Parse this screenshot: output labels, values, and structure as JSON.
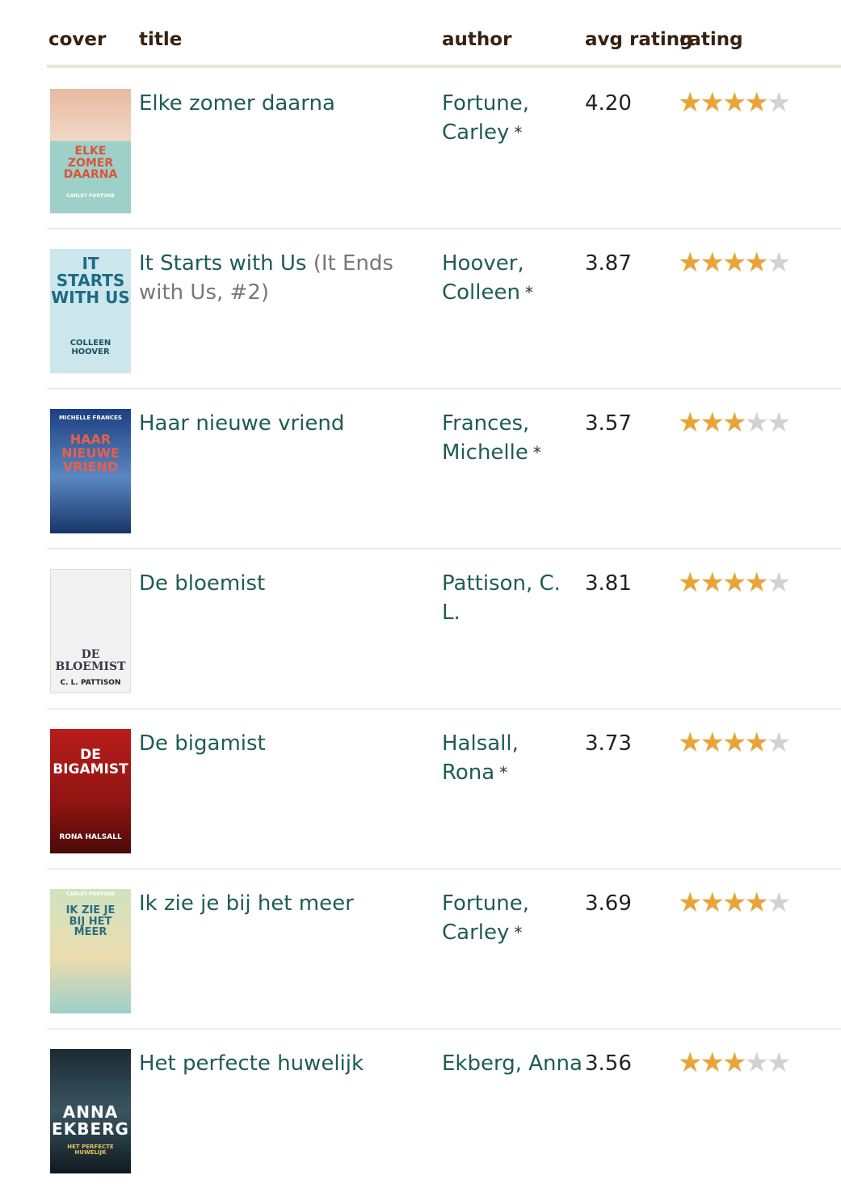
{
  "header": {
    "cover": "cover",
    "title": "title",
    "author": "author",
    "avg_rating": "avg rating",
    "rating": "rating"
  },
  "colors": {
    "link": "#1e5c55",
    "header_text": "#382110",
    "star_on": "#e8a43a",
    "star_off": "#d2d2d2"
  },
  "books": [
    {
      "title": "Elke zomer daarna",
      "series": "",
      "author": "Fortune, Carley",
      "author_mark": "*",
      "avg_rating": "4.20",
      "stars": 4,
      "cover_text": "ELKE ZOMER DAARNA",
      "cover_author": "CARLEY FORTUNE"
    },
    {
      "title": "It Starts with Us",
      "series": "(It Ends with Us, #2)",
      "author": "Hoover, Colleen",
      "author_mark": "*",
      "avg_rating": "3.87",
      "stars": 4,
      "cover_text": "IT STARTS WITH US",
      "cover_author": "COLLEEN HOOVER"
    },
    {
      "title": "Haar nieuwe vriend",
      "series": "",
      "author": "Frances, Michelle",
      "author_mark": "*",
      "avg_rating": "3.57",
      "stars": 3,
      "cover_text": "HAAR NIEUWE VRIEND",
      "cover_author": "MICHELLE FRANCES"
    },
    {
      "title": "De bloemist",
      "series": "",
      "author": "Pattison, C. L.",
      "author_mark": "",
      "avg_rating": "3.81",
      "stars": 4,
      "cover_text": "DE BLOEMIST",
      "cover_author": "C. L. PATTISON"
    },
    {
      "title": "De bigamist",
      "series": "",
      "author": "Halsall, Rona",
      "author_mark": "*",
      "avg_rating": "3.73",
      "stars": 4,
      "cover_text": "DE BIGAMIST",
      "cover_author": "RONA HALSALL"
    },
    {
      "title": "Ik zie je bij het meer",
      "series": "",
      "author": "Fortune, Carley",
      "author_mark": "*",
      "avg_rating": "3.69",
      "stars": 4,
      "cover_text": "IK ZIE JE BIJ HET MEER",
      "cover_author": "CARLEY FORTUNE"
    },
    {
      "title": "Het perfecte huwelijk",
      "series": "",
      "author": "Ekberg, Anna",
      "author_mark": "",
      "avg_rating": "3.56",
      "stars": 3,
      "cover_text": "ANNA EKBERG",
      "cover_author": "HET PERFECTE HUWELIJK"
    }
  ]
}
